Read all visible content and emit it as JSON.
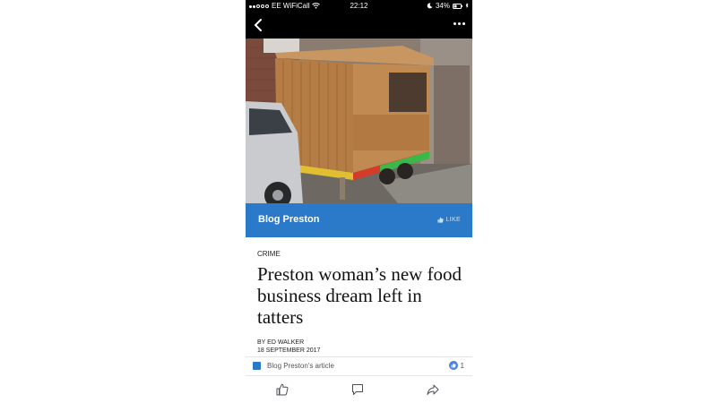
{
  "status_bar": {
    "carrier": "EE WiFiCall",
    "time": "22:12",
    "battery": "34%"
  },
  "colors": {
    "accent": "#2a7ac9",
    "status_bar_bg": "#000000"
  },
  "icons": {
    "back": "chevron-left-icon",
    "more": "more-dots-icon",
    "like": "thumbs-up-icon",
    "comment": "comment-icon",
    "share": "share-icon"
  },
  "page_header": {
    "name": "Blog Preston",
    "like_label": "LIKE"
  },
  "article": {
    "category": "CRIME",
    "headline": "Preston woman’s new food business dream left in tatters",
    "author": "BY ED WALKER",
    "date": "18 SEPTEMBER 2017"
  },
  "footer": {
    "source_label": "Blog Preston's article",
    "reaction_count": "1"
  }
}
